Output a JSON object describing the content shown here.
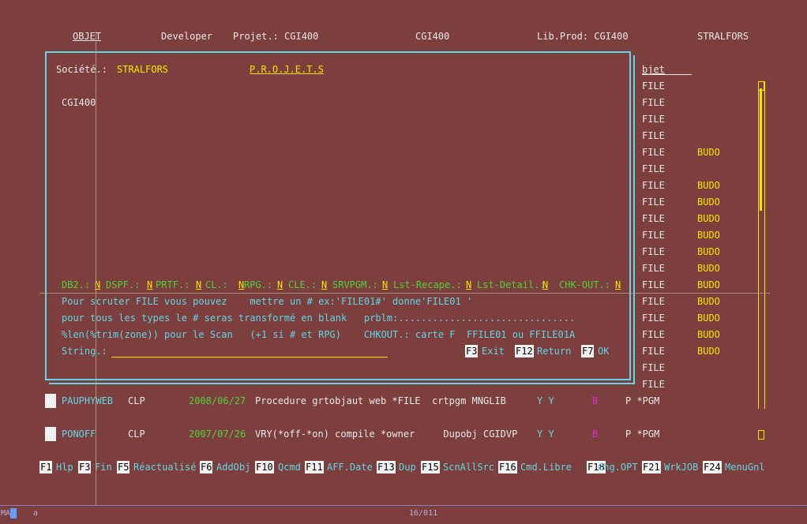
{
  "header": {
    "objet": "OBJET",
    "user": "Developer",
    "projet": "Projet.: CGI400",
    "center": "CGI400",
    "lib_prod": "Lib.Prod: CGI400",
    "company": "STRALFORS"
  },
  "panel": {
    "societe_label": "Société.:",
    "societe_value": "STRALFORS",
    "title": "P.R.O.J.E.T.S",
    "project": "CGI400",
    "flags": [
      {
        "label": "DB2.:",
        "value": "N"
      },
      {
        "label": "DSPF.:",
        "value": "N"
      },
      {
        "label": "PRTF.:",
        "value": "N"
      },
      {
        "label": "CL.:",
        "value": "N"
      },
      {
        "label": "RPG.:",
        "value": "N"
      },
      {
        "label": "CLE.:",
        "value": "N"
      },
      {
        "label": "SRVPGM.:",
        "value": "N"
      },
      {
        "label": "Lst-Recape.:",
        "value": "N"
      },
      {
        "label": "Lst-Detail.:",
        "value": "N"
      },
      {
        "label": "CHK-OUT.:",
        "value": "N"
      }
    ],
    "help_line1": "Pour scruter FILE vous pouvez    mettre un # ex:'FILE01#' donne'FILE01 '",
    "help_line2": "pour tous les types le # seras transformé en blank   prblm:...............................",
    "help_line3": "%len(%trim(zone)) pour le Scan   (+1 si # et RPG)    CHKOUT.: carte F  FFILE01 ou FFILE01A",
    "string_label": "String.:",
    "string_value": "",
    "keys": [
      {
        "key": "F3",
        "label": "Exit"
      },
      {
        "key": "F12",
        "label": "Return"
      },
      {
        "key": "F7",
        "label": "OK"
      }
    ]
  },
  "right_column": {
    "header": "bjet",
    "rows": [
      {
        "type": "FILE",
        "tag": ""
      },
      {
        "type": "FILE",
        "tag": ""
      },
      {
        "type": "FILE",
        "tag": ""
      },
      {
        "type": "FILE",
        "tag": ""
      },
      {
        "type": "FILE",
        "tag": "BUDO"
      },
      {
        "type": "FILE",
        "tag": ""
      },
      {
        "type": "FILE",
        "tag": "BUDO"
      },
      {
        "type": "FILE",
        "tag": "BUDO"
      },
      {
        "type": "FILE",
        "tag": "BUDO"
      },
      {
        "type": "FILE",
        "tag": "BUDO"
      },
      {
        "type": "FILE",
        "tag": "BUDO"
      },
      {
        "type": "FILE",
        "tag": "BUDO"
      },
      {
        "type": "FILE",
        "tag": "BUDO"
      },
      {
        "type": "FILE",
        "tag": "BUDO"
      },
      {
        "type": "FILE",
        "tag": "BUDO"
      },
      {
        "type": "FILE",
        "tag": "BUDO"
      },
      {
        "type": "FILE",
        "tag": "BUDO"
      },
      {
        "type": "FILE",
        "tag": ""
      },
      {
        "type": "FILE",
        "tag": ""
      }
    ]
  },
  "list_rows": [
    {
      "name": "PAUPHYWEB",
      "type": "CLP",
      "date": "2008/06/27",
      "desc": "Procedure grtobjaut web *FILE  crtpgm MNGLIB",
      "flags": "Y Y",
      "mark": "B",
      "attr": "P *PGM"
    },
    {
      "name": "PONOFF",
      "type": "CLP",
      "date": "2007/07/26",
      "desc": "VRY(*off-*on) compile *owner     Dupobj CGIDVP",
      "flags": "Y Y",
      "mark": "B",
      "attr": "P *PGM"
    }
  ],
  "function_keys": [
    {
      "key": "F1",
      "label": "Hlp"
    },
    {
      "key": "F3",
      "label": "Fin"
    },
    {
      "key": "F5",
      "label": "Réactualisé"
    },
    {
      "key": "F6",
      "label": "AddObj"
    },
    {
      "key": "F10",
      "label": "Qcmd"
    },
    {
      "key": "F11",
      "label": "AFF.Date"
    },
    {
      "key": "F13",
      "label": "Dup"
    },
    {
      "key": "F15",
      "label": "ScnAllSrc"
    },
    {
      "key": "F16",
      "label": "Cmd.Libre"
    },
    {
      "key": "F18",
      "label": "Chg.OPT"
    },
    {
      "key": "F21",
      "label": "WrkJOB"
    },
    {
      "key": "F24",
      "label": "MenuGnl"
    }
  ],
  "status": {
    "mode": "MA",
    "input": "a",
    "position": "16/011"
  },
  "colors": {
    "background": "#7d3e3e",
    "cyan": "#5fd7e6",
    "yellow": "#f2e600",
    "green": "#4fd13a",
    "magenta": "#e02ad8"
  }
}
